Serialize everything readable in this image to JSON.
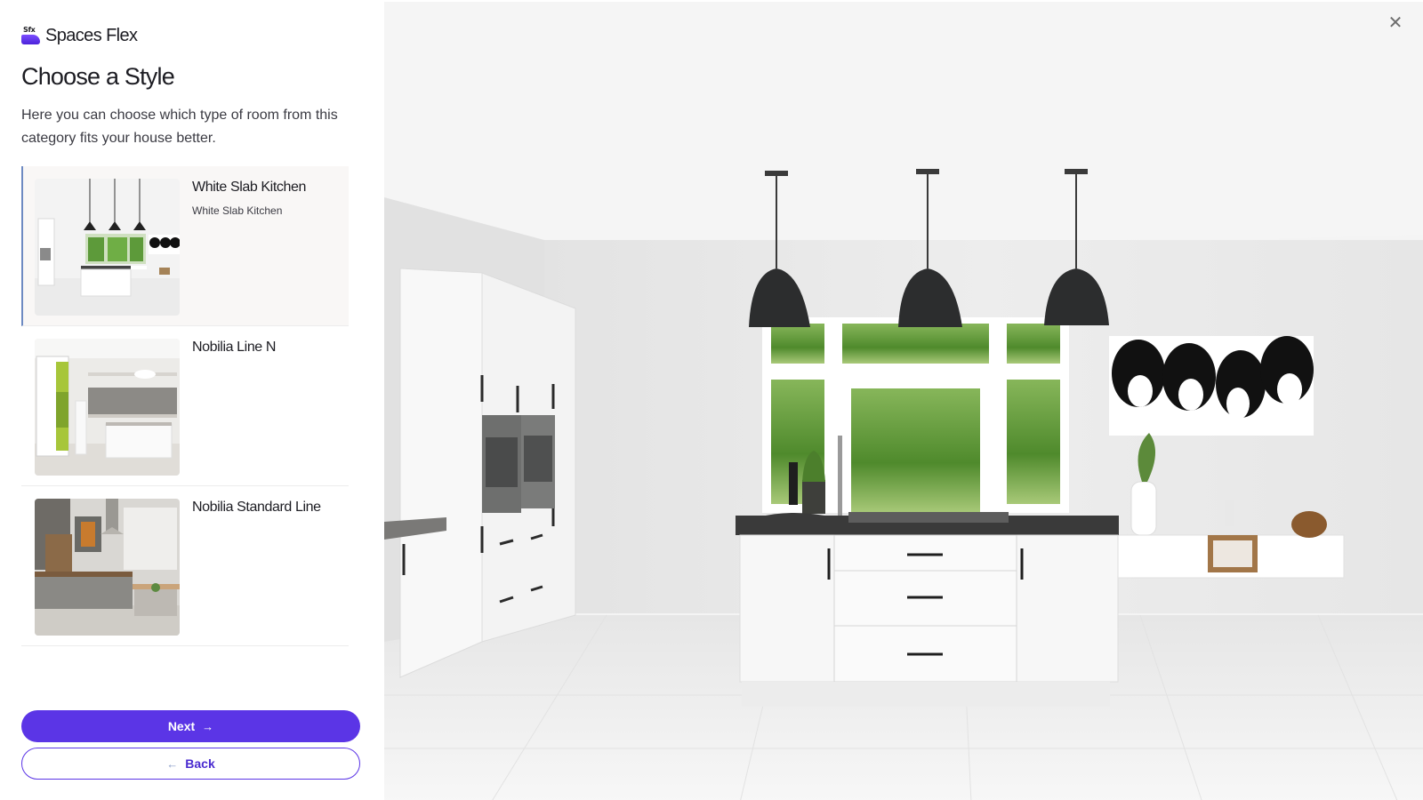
{
  "brand": {
    "logo_text": "Sfx",
    "name": "Spaces Flex"
  },
  "header": {
    "title": "Choose a Style",
    "description": "Here you can choose which type of room from this category fits your house better."
  },
  "styles": [
    {
      "name": "White Slab Kitchen",
      "subtitle": "White Slab Kitchen",
      "selected": true
    },
    {
      "name": "Nobilia Line N",
      "subtitle": "",
      "selected": false
    },
    {
      "name": "Nobilia Standard Line",
      "subtitle": "",
      "selected": false
    }
  ],
  "actions": {
    "next_label": "Next",
    "back_label": "Back"
  },
  "icons": {
    "next": "arrow-right-icon",
    "back": "arrow-left-icon",
    "close": "close-icon"
  },
  "colors": {
    "accent": "#5b35e6",
    "selected_bg": "#f9f7f6",
    "selected_border": "#6d8ac2"
  }
}
